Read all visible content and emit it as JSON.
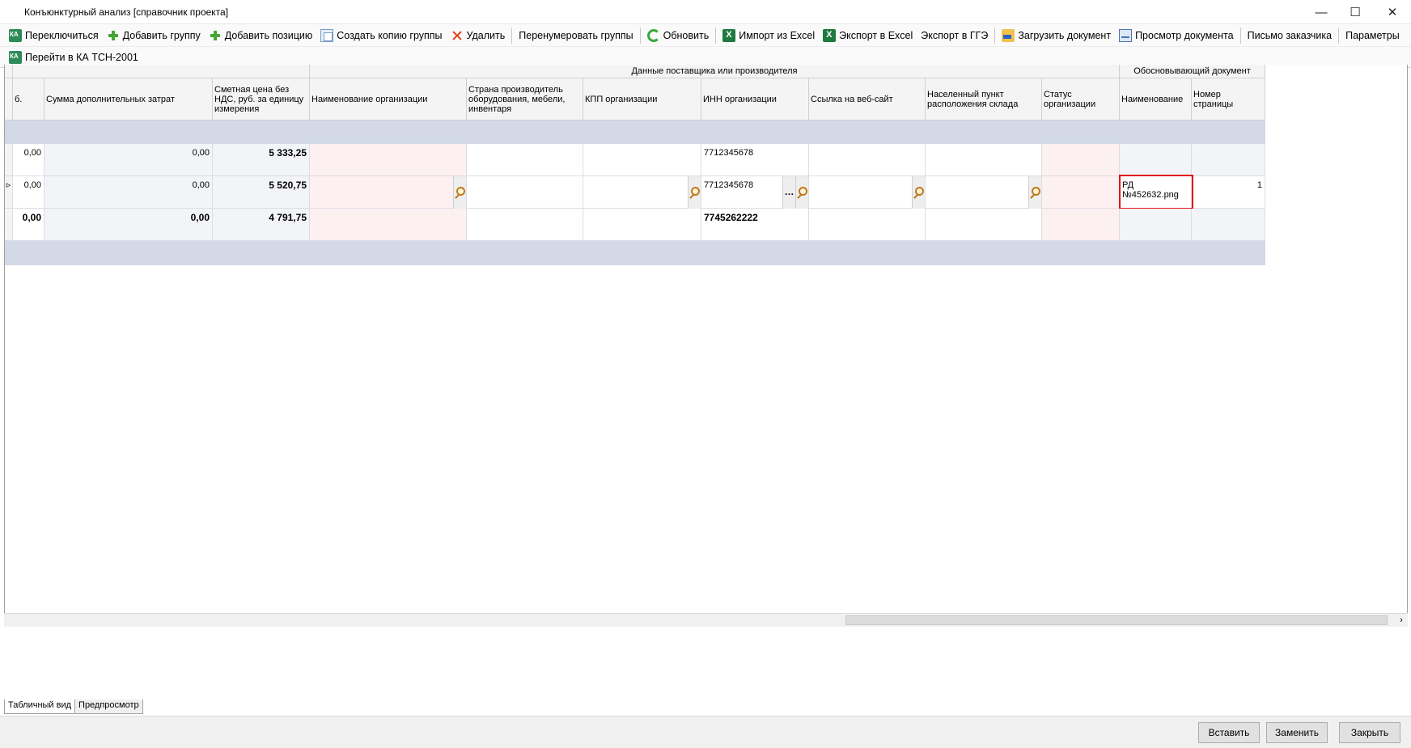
{
  "window": {
    "title": "Конъюнктурный анализ [справочник проекта]",
    "minimize_glyph": "—",
    "maximize_glyph": "☐",
    "close_glyph": "✕"
  },
  "toolbar": {
    "switch_label": "Переключиться",
    "add_group_label": "Добавить группу",
    "add_position_label": "Добавить позицию",
    "copy_group_label": "Создать копию группы",
    "delete_label": "Удалить",
    "renumber_label": "Перенумеровать группы",
    "refresh_label": "Обновить",
    "import_excel_label": "Импорт из Excel",
    "export_excel_label": "Экспорт в Excel",
    "export_gge_label": "Экспорт в ГГЭ",
    "load_doc_label": "Загрузить документ",
    "view_doc_label": "Просмотр документа",
    "customer_letter_label": "Письмо заказчика",
    "params_label": "Параметры",
    "goto_ka_label": "Перейти в КА ТСН-2001"
  },
  "grid": {
    "group_headers": {
      "supplier": "Данные поставщика или производителя",
      "doc": "Обосновывающий документ"
    },
    "columns": {
      "cut": "б.",
      "extra": "Сумма дополнительных затрат",
      "price": "Сметная цена без НДС, руб. за единицу измерения",
      "org": "Наименование организации",
      "country": "Страна производитель оборудования, мебели, инвентаря",
      "kpp": "КПП организации",
      "inn": "ИНН организации",
      "site": "Ссылка на веб-сайт",
      "city": "Населенный пункт расположения склада",
      "status": "Статус организации",
      "docname": "Наименование",
      "page": "Номер страницы"
    },
    "rows": [
      {
        "cut": "0,00",
        "extra": "0,00",
        "price": "5 333,25",
        "inn": "7712345678",
        "docname": "",
        "page": ""
      },
      {
        "cut": "0,00",
        "extra": "0,00",
        "price": "5 520,75",
        "inn": "7712345678",
        "docname": "РД №452632.png",
        "page": "1"
      },
      {
        "cut": "0,00",
        "extra": "0,00",
        "price": "4 791,75",
        "inn": "7745262222",
        "docname": "",
        "page": ""
      }
    ],
    "current_row_marker": "▹",
    "ellipsis_glyph": "…",
    "scroll_right_glyph": "›"
  },
  "tabs": [
    "Табличный вид",
    "Предпросмотр"
  ],
  "buttons": {
    "insert": "Вставить",
    "replace": "Заменить",
    "close": "Закрыть"
  }
}
